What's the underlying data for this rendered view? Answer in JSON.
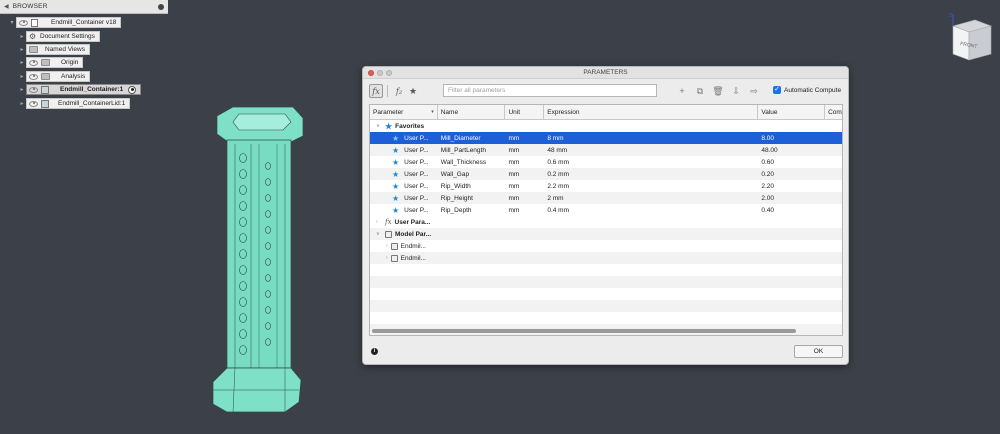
{
  "browser": {
    "title": "BROWSER",
    "items": [
      {
        "label": "Endmill_Container v18",
        "icon": "document-icon"
      },
      {
        "label": "Document Settings",
        "icon": "gear-icon"
      },
      {
        "label": "Named Views",
        "icon": "folder-icon"
      },
      {
        "label": "Origin",
        "icon": "folder-icon"
      },
      {
        "label": "Analysis",
        "icon": "folder-icon"
      },
      {
        "label": "Endmill_Container:1",
        "icon": "component-icon",
        "active": true
      },
      {
        "label": "Endmill_ContainerLid:1",
        "icon": "component-icon"
      }
    ]
  },
  "viewcube": {
    "label": "FRONT",
    "axis": "Z"
  },
  "dialog": {
    "title": "PARAMETERS",
    "filter_placeholder": "Filter all parameters",
    "auto_compute_label": "Automatic Compute",
    "auto_compute_checked": true,
    "columns": [
      "Parameter",
      "Name",
      "Unit",
      "Expression",
      "Value",
      "Com"
    ],
    "groups": {
      "favorites": "Favorites",
      "user": "User Para...",
      "model": "Model Par..."
    },
    "favorites": [
      {
        "param": "User P...",
        "name": "Mill_Diameter",
        "unit": "mm",
        "expression": "8 mm",
        "value": "8.00",
        "selected": true
      },
      {
        "param": "User P...",
        "name": "Mill_PartLength",
        "unit": "mm",
        "expression": "48 mm",
        "value": "48.00"
      },
      {
        "param": "User P...",
        "name": "Wall_Thickness",
        "unit": "mm",
        "expression": "0.6 mm",
        "value": "0.60"
      },
      {
        "param": "User P...",
        "name": "Wall_Gap",
        "unit": "mm",
        "expression": "0.2 mm",
        "value": "0.20"
      },
      {
        "param": "User P...",
        "name": "Rip_Width",
        "unit": "mm",
        "expression": "2.2 mm",
        "value": "2.20"
      },
      {
        "param": "User P...",
        "name": "Rip_Height",
        "unit": "mm",
        "expression": "2 mm",
        "value": "2.00"
      },
      {
        "param": "User P...",
        "name": "Rip_Depth",
        "unit": "mm",
        "expression": "0.4 mm",
        "value": "0.40"
      }
    ],
    "model_children": [
      "Endmil...",
      "Endmil..."
    ],
    "ok_label": "OK"
  },
  "colors": {
    "background": "#3c4149",
    "selection": "#1d5fd6",
    "star": "#1e88d6",
    "model": "#7fe0c8"
  }
}
